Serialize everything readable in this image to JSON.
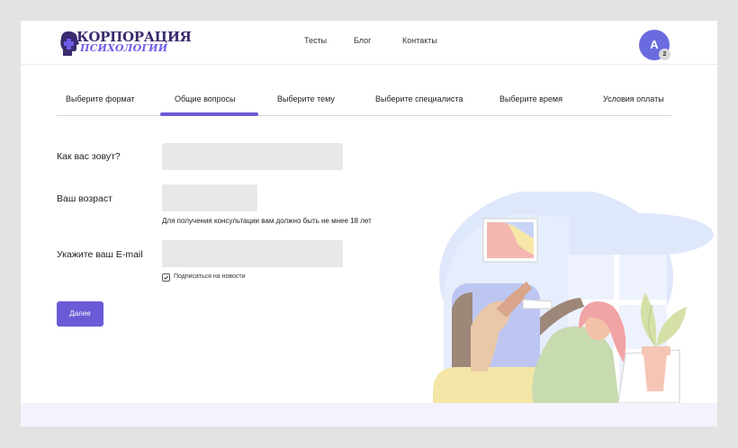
{
  "header": {
    "logo_top": "КОРПОРАЦИЯ",
    "logo_bottom": "ПСИХОЛОГИИ",
    "nav": [
      "Тесты",
      "Блог",
      "Контакты"
    ],
    "avatar_letter": "А",
    "notification_count": "2"
  },
  "tabs": [
    {
      "label": "Выберите формат",
      "active": false
    },
    {
      "label": "Общие вопросы",
      "active": true
    },
    {
      "label": "Выберите тему",
      "active": false
    },
    {
      "label": "Выберите специалиста",
      "active": false
    },
    {
      "label": "Выберите время",
      "active": false
    },
    {
      "label": "Условия оплаты",
      "active": false
    }
  ],
  "form": {
    "name_label": "Как вас зовут?",
    "name_value": "",
    "age_label": "Ваш возраст",
    "age_value": "",
    "age_hint": "Для получения консультации вам должно быть не мнее 18 лет",
    "email_label": "Укажите ваш E-mail",
    "email_value": "",
    "subscribe_label": "Подписаться на новости",
    "subscribe_checked": true,
    "submit_label": "Далее"
  },
  "colors": {
    "accent": "#6b5bd6",
    "avatar": "#6b6be0",
    "input_bg": "#e8e8e8",
    "footer_band": "#f4f2fd"
  }
}
